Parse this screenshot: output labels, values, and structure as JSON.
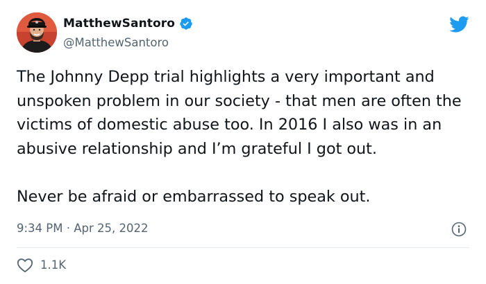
{
  "author": {
    "display_name": "MatthewSantoro",
    "handle": "@MatthewSantoro",
    "verified": true,
    "avatar_icon": "profile-photo"
  },
  "tweet": {
    "paragraphs": [
      "The Johnny Depp trial highlights a very important and unspoken problem in our society - that men are often the victims of domestic abuse too. In 2016 I also was in an abusive relationship and I’m grateful I got out.",
      "Never be afraid or embarrassed to speak out."
    ],
    "timestamp": "9:34 PM · Apr 25, 2022"
  },
  "engagement": {
    "likes": "1.1K",
    "like_icon": "heart-icon"
  },
  "icons": {
    "brand": "twitter-bird-icon",
    "info": "info-icon",
    "verified": "verified-badge-icon"
  },
  "colors": {
    "twitter_blue": "#1d9bf0",
    "text_primary": "#0f1419",
    "text_secondary": "#536471",
    "divider": "#e1e8ed"
  }
}
